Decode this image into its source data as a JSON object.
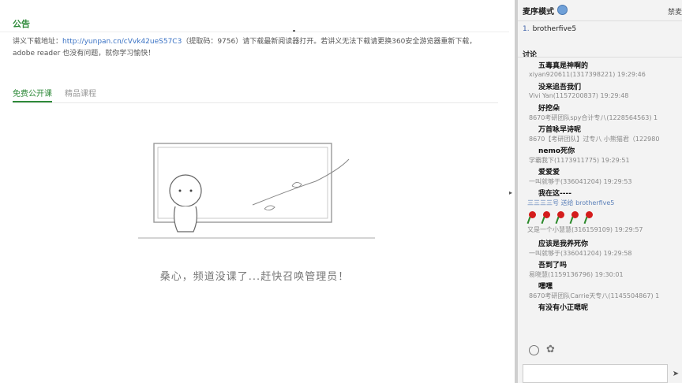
{
  "notice": {
    "title": "公告",
    "text_prefix": "讲义下载地址：",
    "link": "http://yunpan.cn/cVvk42ueS57C3",
    "text_suffix": "（提取码：9756）请下载最新阅读器打开。若讲义无法下载请更换360安全游览器重新下载，adobe reader 也没有问题，就你学习愉快！"
  },
  "tabs": [
    {
      "label": "免费公开课",
      "active": true
    },
    {
      "label": "精品课程",
      "active": false
    }
  ],
  "empty_message": "桑心，频道没课了...赶快召唤管理员！",
  "sidebar": {
    "mic_mode": "麦序模式",
    "ban_label": "禁麦",
    "mic_queue": [
      {
        "num": "1.",
        "name": "brotherfive5"
      }
    ],
    "discussion_title": "讨论",
    "messages": [
      {
        "text": "五毒真是神啊的",
        "meta": "xiyan920611(1317398221) 19:29:46"
      },
      {
        "text": "没来追吾我们",
        "meta": "Vivi Yan(1157200837) 19:29:48"
      },
      {
        "text": "好挖朵",
        "meta": "8670考研团队spy合计专八(1228564563) 1"
      },
      {
        "text": "万首咏早诗呢",
        "meta": "8670【考研团队】过专八 小熊猫君（122980"
      },
      {
        "text": "nemo死你",
        "meta": "学霸我下(1173911775) 19:29:51"
      },
      {
        "text": "爱爱爱",
        "meta": "一叫就够于(336041204) 19:29:53"
      },
      {
        "text": "我在这----",
        "meta": ""
      }
    ],
    "gift_line": "三三三三号 送给 brotherfive5",
    "rose_count": 5,
    "messages2": [
      {
        "text": "又是一个小慧慧(316159109) 19:29:57",
        "meta": "",
        "plain": true
      },
      {
        "text": "应该是我养死你",
        "meta": "一叫就够于(336041204) 19:29:58"
      },
      {
        "text": "吾到了吗",
        "meta": "易晓慧(1159136796) 19:30:01"
      },
      {
        "text": "嘿嘿",
        "meta": "8670考研团队Carrie天专八(1145504867) 1"
      },
      {
        "text": "有没有小正嗯呢",
        "meta": ""
      }
    ],
    "send_label": "发"
  },
  "colors": {
    "accent": "#2f8a3a",
    "link": "#3a72c4"
  }
}
